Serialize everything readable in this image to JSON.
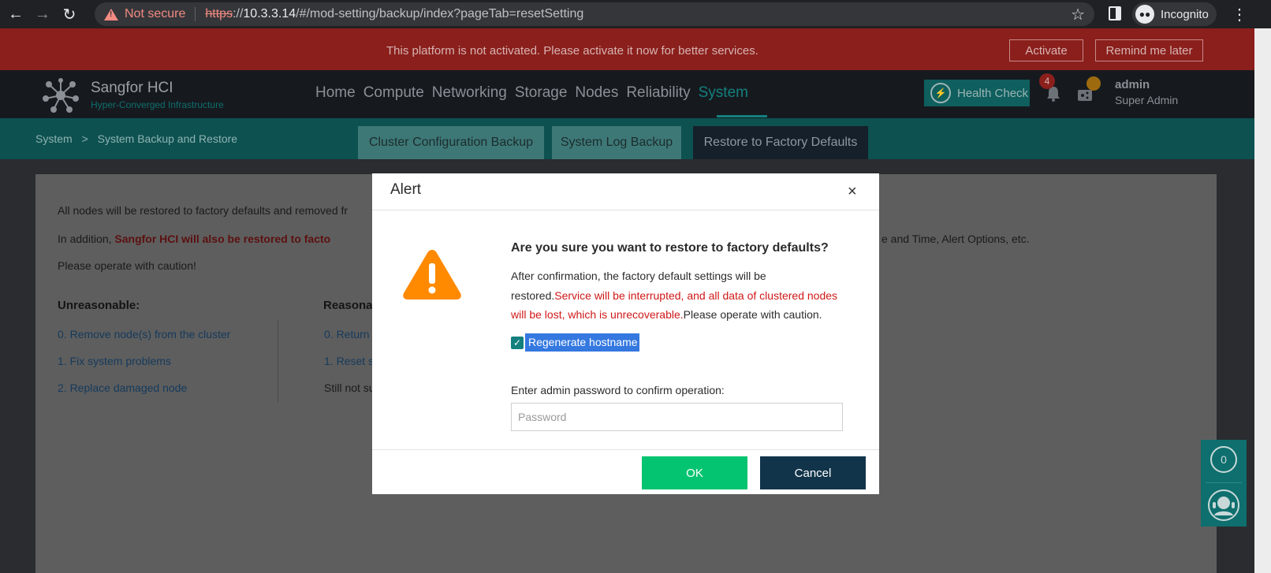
{
  "browser": {
    "not_secure": "Not secure",
    "url_scheme": "https",
    "url_sep": "://",
    "url_host": "10.3.3.14",
    "url_path": "/#/mod-setting/backup/index?pageTab=resetSetting",
    "profile_label": "Incognito"
  },
  "activation": {
    "message": "This platform is not activated. Please activate it now for better services.",
    "activate_label": "Activate",
    "remind_label": "Remind me later"
  },
  "header": {
    "brand_name": "Sangfor HCI",
    "brand_sub": "Hyper-Converged Infrastructure",
    "nav": [
      "Home",
      "Compute",
      "Networking",
      "Storage",
      "Nodes",
      "Reliability",
      "System"
    ],
    "active_nav": "System",
    "health_check": "Health Check",
    "notification_count": "4",
    "user_name": "admin",
    "user_role": "Super Admin"
  },
  "breadcrumb": {
    "root": "System",
    "separator": ">",
    "current": "System Backup and Restore"
  },
  "tabs": [
    "Cluster Configuration Backup",
    "System Log Backup",
    "Restore to Factory Defaults"
  ],
  "content": {
    "line1": "All nodes will be restored to factory defaults and removed fr",
    "line2_prefix": "In addition, ",
    "line2_red": "Sangfor HCI will also be restored to facto",
    "line2_tail": "e and Time, Alert Options, etc.",
    "line3": "Please operate with caution!",
    "unreasonable_heading": "Unreasonable:",
    "unreasonable_items": [
      "0. Remove node(s) from the cluster",
      "1. Fix system problems",
      "2. Replace damaged node"
    ],
    "reasonable_heading": "Reasona",
    "reasonable_items": [
      "0. Return",
      "1. Reset s"
    ],
    "still_text": "Still not su"
  },
  "dialog": {
    "title": "Alert",
    "close": "×",
    "question": "Are you sure you want to restore to factory defaults?",
    "body_plain1": "After confirmation, the factory default settings will be restored.",
    "body_red": "Service will be interrupted, and all data of clustered nodes will be lost, which is unrecoverable.",
    "body_plain2": "Please operate with caution.",
    "checkbox_label": "Regenerate hostname",
    "checkbox_checked": true,
    "password_label": "Enter admin password to confirm operation:",
    "password_placeholder": "Password",
    "ok_label": "OK",
    "cancel_label": "Cancel"
  },
  "float": {
    "count": "0"
  },
  "colors": {
    "accent": "#13807e",
    "ok_button": "#05c471",
    "cancel_button": "#11344a",
    "warning": "#ff8a00",
    "danger_text": "#d01818"
  },
  "icons": [
    "back-arrow-icon",
    "forward-arrow-icon",
    "reload-icon",
    "warning-icon",
    "star-icon",
    "side-panel-icon",
    "incognito-icon",
    "kebab-menu-icon",
    "sangfor-logo-icon",
    "health-check-icon",
    "bell-icon",
    "share-icon",
    "close-icon",
    "alert-triangle-icon",
    "checkbox-check-icon",
    "support-agent-icon"
  ]
}
